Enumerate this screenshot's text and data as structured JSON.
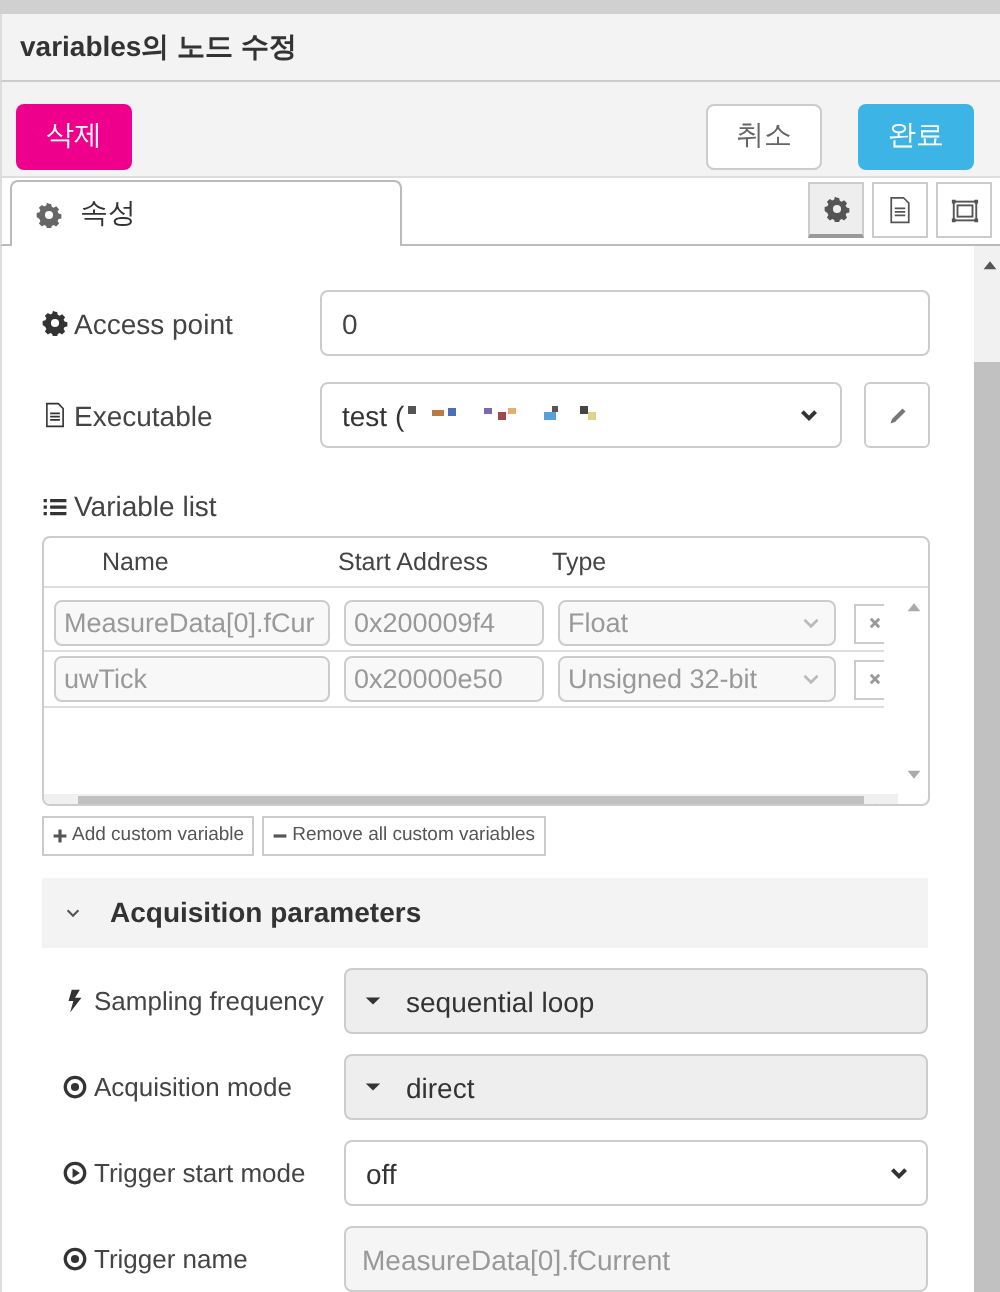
{
  "dialog": {
    "title": "variables의 노드 수정"
  },
  "buttons": {
    "delete": "삭제",
    "cancel": "취소",
    "done": "완료"
  },
  "tabs": [
    {
      "label": "속성",
      "selected": true
    }
  ],
  "tab_icons": [
    {
      "kind": "gear",
      "selected": true
    },
    {
      "kind": "file",
      "selected": false
    },
    {
      "kind": "frame",
      "selected": false
    }
  ],
  "access_point": {
    "label": "Access point",
    "value": "0"
  },
  "executable": {
    "label": "Executable",
    "value": "test ("
  },
  "variable_list": {
    "label": "Variable list",
    "columns": [
      "Name",
      "Start Address",
      "Type"
    ],
    "rows": [
      {
        "name": "MeasureData[0].fCur",
        "address": "0x200009f4",
        "type": "Float",
        "disabled": true
      },
      {
        "name": "uwTick",
        "address": "0x20000e50",
        "type": "Unsigned 32-bit",
        "disabled": true
      }
    ],
    "add_button": "Add custom variable",
    "remove_button": "Remove all custom variables"
  },
  "acquisition": {
    "title": "Acquisition parameters",
    "expanded": true,
    "rows": [
      {
        "kind": "static",
        "label": "Sampling frequency",
        "value": "sequential loop"
      },
      {
        "kind": "static",
        "label": "Acquisition mode",
        "value": "direct"
      },
      {
        "kind": "select",
        "label": "Trigger start mode",
        "value": "off"
      },
      {
        "kind": "disabled",
        "label": "Trigger name",
        "value": "MeasureData[0].fCurrent"
      }
    ]
  }
}
